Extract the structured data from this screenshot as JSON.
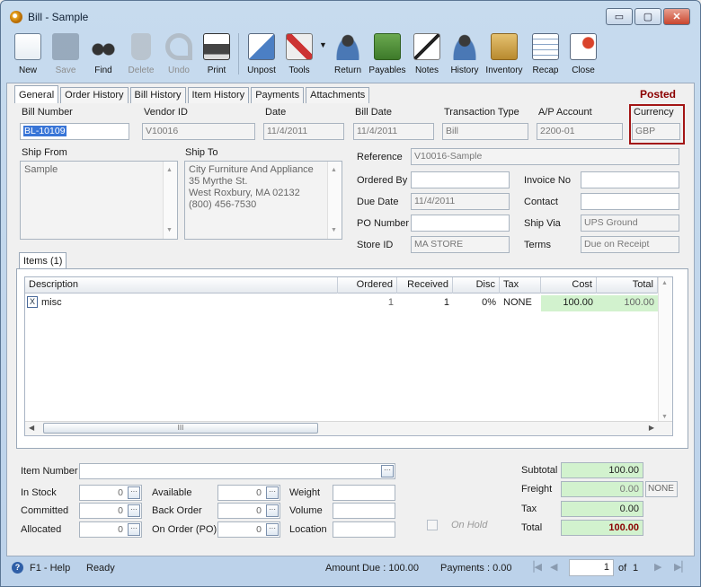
{
  "window": {
    "title": "Bill - Sample",
    "minimize": "▭",
    "maximize": "▢",
    "close": "✕"
  },
  "toolbar": [
    {
      "label": "New",
      "icon": "new-document-icon",
      "enabled": true
    },
    {
      "label": "Save",
      "icon": "floppy-disk-icon",
      "enabled": false
    },
    {
      "label": "Find",
      "icon": "binoculars-icon",
      "enabled": true
    },
    {
      "label": "Delete",
      "icon": "trash-can-icon",
      "enabled": false
    },
    {
      "label": "Undo",
      "icon": "undo-arrow-icon",
      "enabled": false
    },
    {
      "label": "Print",
      "icon": "printer-icon",
      "enabled": true
    },
    {
      "label": "Unpost",
      "icon": "unpost-icon",
      "enabled": true
    },
    {
      "label": "Tools",
      "icon": "tools-icon",
      "enabled": true
    },
    {
      "label": "Return",
      "icon": "return-user-icon",
      "enabled": true
    },
    {
      "label": "Payables",
      "icon": "payables-money-icon",
      "enabled": true
    },
    {
      "label": "Notes",
      "icon": "notes-pen-icon",
      "enabled": true
    },
    {
      "label": "History",
      "icon": "history-user-icon",
      "enabled": true
    },
    {
      "label": "Inventory",
      "icon": "inventory-boxes-icon",
      "enabled": true
    },
    {
      "label": "Recap",
      "icon": "recap-table-icon",
      "enabled": true
    },
    {
      "label": "Close",
      "icon": "close-window-icon",
      "enabled": true
    }
  ],
  "tabs": [
    "General",
    "Order History",
    "Bill History",
    "Item History",
    "Payments",
    "Attachments"
  ],
  "status_posted": "Posted",
  "header": {
    "bill_number_label": "Bill Number",
    "bill_number": "BL-10109",
    "vendor_id_label": "Vendor ID",
    "vendor_id": "V10016",
    "date_label": "Date",
    "date": "11/4/2011",
    "bill_date_label": "Bill Date",
    "bill_date": "11/4/2011",
    "transaction_type_label": "Transaction Type",
    "transaction_type": "Bill",
    "ap_account_label": "A/P Account",
    "ap_account": "2200-01",
    "currency_label": "Currency",
    "currency": "GBP"
  },
  "ship_from": {
    "label": "Ship From",
    "value": "Sample"
  },
  "ship_to": {
    "label": "Ship To",
    "lines": [
      "City Furniture And Appliance",
      "35 Myrthe St.",
      "West Roxbury, MA 02132",
      "(800) 456-7530"
    ]
  },
  "details": {
    "reference_label": "Reference",
    "reference": "V10016-Sample",
    "ordered_by_label": "Ordered By",
    "ordered_by": "",
    "invoice_no_label": "Invoice No",
    "invoice_no": "",
    "due_date_label": "Due Date",
    "due_date": "11/4/2011",
    "contact_label": "Contact",
    "contact": "",
    "po_number_label": "PO Number",
    "po_number": "",
    "ship_via_label": "Ship Via",
    "ship_via": "UPS Ground",
    "store_id_label": "Store ID",
    "store_id": "MA STORE",
    "terms_label": "Terms",
    "terms": "Due on Receipt"
  },
  "items_tab": "Items (1)",
  "grid": {
    "columns": [
      "Description",
      "Ordered",
      "Received",
      "Disc",
      "Tax",
      "Cost",
      "Total"
    ],
    "rows": [
      {
        "checkbox": "X",
        "description": "misc",
        "ordered": "1",
        "received": "1",
        "disc": "0%",
        "tax": "NONE",
        "cost": "100.00",
        "total": "100.00"
      }
    ],
    "hscroll_thumb": "III"
  },
  "bottom": {
    "item_number_label": "Item Number",
    "in_stock_label": "In Stock",
    "in_stock": "0",
    "committed_label": "Committed",
    "committed": "0",
    "allocated_label": "Allocated",
    "allocated": "0",
    "available_label": "Available",
    "available": "0",
    "back_order_label": "Back Order",
    "back_order": "0",
    "on_order_label": "On Order (PO)",
    "on_order": "0",
    "weight_label": "Weight",
    "volume_label": "Volume",
    "location_label": "Location",
    "on_hold_label": "On Hold",
    "ellipsis": "···"
  },
  "totals": {
    "subtotal_label": "Subtotal",
    "subtotal": "100.00",
    "freight_label": "Freight",
    "freight": "0.00",
    "freight_tax": "NONE",
    "tax_label": "Tax",
    "tax": "0.00",
    "total_label": "Total",
    "total": "100.00"
  },
  "statusbar": {
    "help": "F1 - Help",
    "state": "Ready",
    "amount_due": "Amount Due : 100.00",
    "payments": "Payments : 0.00",
    "page": "1",
    "of": "of",
    "page_count": "1"
  },
  "colors": {
    "accent": "#3875d7",
    "posted": "#8b0000",
    "highlight_box": "#a31515",
    "green_cell": "#d2f2ce"
  }
}
